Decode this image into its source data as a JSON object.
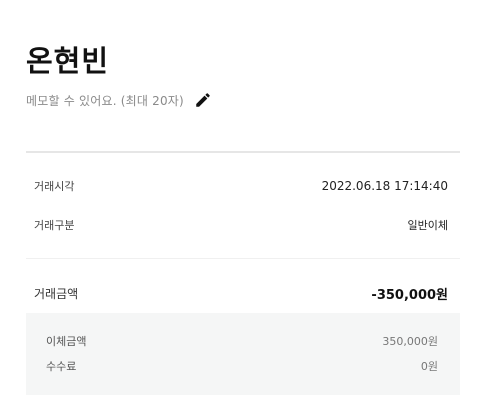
{
  "header": {
    "name": "온현빈"
  },
  "memo": {
    "placeholder": "메모할 수 있어요. (최대 20자)",
    "edit_icon": "pencil-icon"
  },
  "details": {
    "time_label": "거래시각",
    "time_value": "2022.06.18 17:14:40",
    "type_label": "거래구분",
    "type_value": "일반이체"
  },
  "amount": {
    "label": "거래금액",
    "value": "-350,000원"
  },
  "breakdown": {
    "transfer_label": "이체금액",
    "transfer_value": "350,000원",
    "fee_label": "수수료",
    "fee_value": "0원"
  }
}
